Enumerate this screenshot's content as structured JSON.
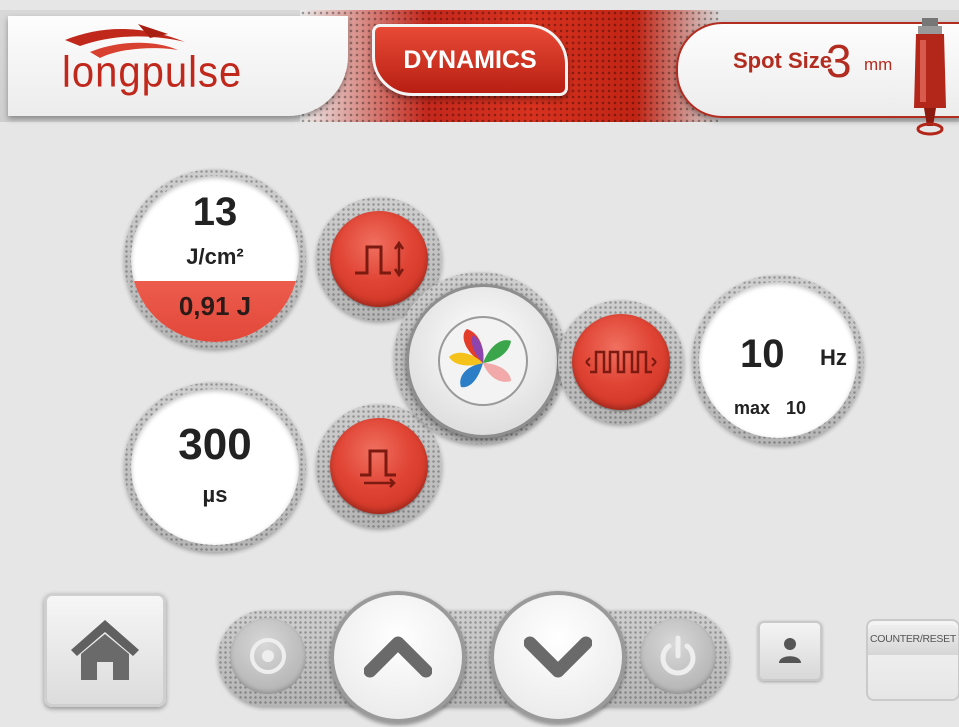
{
  "header": {
    "logo_text": "longpulse",
    "mode_tab": "DYNAMICS",
    "spot_size_label": "Spot Size",
    "spot_size_value": "3",
    "spot_size_unit": "mm"
  },
  "fluence": {
    "value": "13",
    "unit": "J/cm²",
    "energy": "0,91 J"
  },
  "pulse_width": {
    "value": "300",
    "unit": "µs"
  },
  "frequency": {
    "value": "10",
    "unit": "Hz",
    "max_label": "max",
    "max_value": "10"
  },
  "counter": {
    "label": "COUNTER/RESET"
  },
  "colors": {
    "accent_red": "#e04434",
    "dark_red": "#b22c20",
    "ring_grey": "#bdbdbd"
  },
  "icons": [
    "fluence-pulse-icon",
    "pulse-width-icon",
    "frequency-pulse-train-icon",
    "color-fan-logo-icon",
    "home-icon",
    "target-icon",
    "chevron-up-icon",
    "chevron-down-icon",
    "power-icon",
    "user-icon",
    "handpiece-icon"
  ]
}
